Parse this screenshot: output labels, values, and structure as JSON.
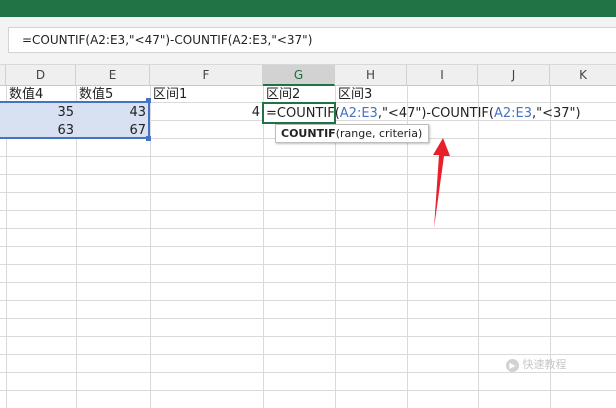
{
  "formula_bar": {
    "text": "=COUNTIF(A2:E3,\"<47\")-COUNTIF(A2:E3,\"<37\")"
  },
  "columns": [
    "D",
    "E",
    "F",
    "G",
    "H",
    "I",
    "J",
    "K"
  ],
  "header_row": {
    "d": "数值4",
    "e": "数值5",
    "f": "区间1",
    "g": "区间2",
    "h": "区间3"
  },
  "data_rows": [
    {
      "d": "35",
      "e": "43",
      "f": "4"
    },
    {
      "d": "63",
      "e": "67"
    }
  ],
  "active_cell": {
    "parts": [
      {
        "text": "=COUNTIF(",
        "ref": false
      },
      {
        "text": "A2:E3",
        "ref": true
      },
      {
        "text": ",\"<47\")-COUNTIF(",
        "ref": false
      },
      {
        "text": "A2:E3",
        "ref": true
      },
      {
        "text": ",\"<37\")",
        "ref": false
      }
    ]
  },
  "tooltip": {
    "func": "COUNTIF",
    "args": "(range, criteria)"
  },
  "watermark": "快速教程",
  "colors": {
    "excel_green": "#217346",
    "ref_blue": "#4472c4",
    "arrow_red": "#e8202a",
    "selection_fill": "#d7e1f2"
  }
}
